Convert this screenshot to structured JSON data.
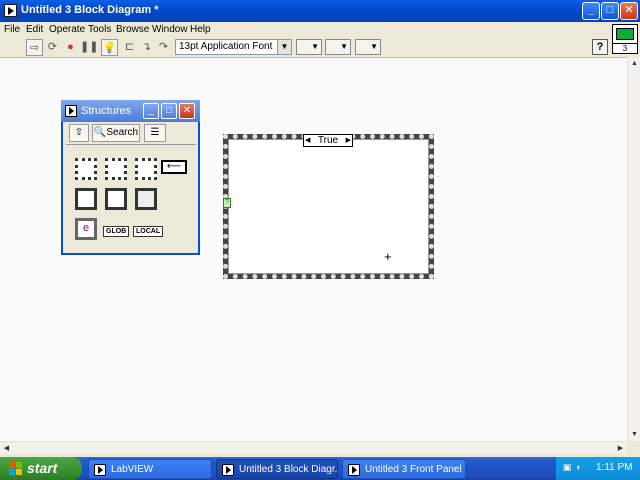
{
  "window": {
    "title": "Untitled 3 Block Diagram *",
    "controls": {
      "minimize": "_",
      "maximize": "□",
      "close": "✕"
    }
  },
  "menu": [
    "File",
    "Edit",
    "Operate",
    "Tools",
    "Browse",
    "Window",
    "Help"
  ],
  "toolbar": {
    "font": "13pt Application Font",
    "vi_icon_number": "3"
  },
  "palette": {
    "title": "Structures",
    "search_label": "Search",
    "glob_label": "GLOB",
    "local_label": "LOCAL",
    "event_label": "e"
  },
  "case_structure": {
    "selector_label": "True",
    "selector_left_arrow": "◀",
    "selector_right_arrow": "▶",
    "terminal_label": "?"
  },
  "taskbar": {
    "start_label": "start",
    "tasks": [
      {
        "label": "LabVIEW",
        "active": false
      },
      {
        "label": "Untitled 3 Block Diagr...",
        "active": true
      },
      {
        "label": "Untitled 3 Front Panel *",
        "active": false
      }
    ],
    "clock": "1:11 PM"
  }
}
